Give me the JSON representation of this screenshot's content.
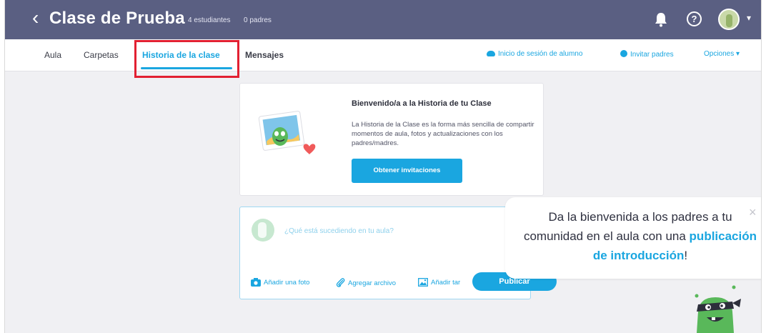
{
  "header": {
    "back_glyph": "‹",
    "class_name": "Clase de Prueba",
    "students_count": "4 estudiantes",
    "parents_count": "0 padres",
    "help_glyph": "?",
    "caret": "▾"
  },
  "nav": {
    "tabs": [
      {
        "label": "Aula"
      },
      {
        "label": "Carpetas"
      },
      {
        "label": "Historia de la clase",
        "active": true
      },
      {
        "label": "Mensajes"
      }
    ],
    "actions": {
      "student_login": "Inicio de sesión de alumno",
      "invite_parents": "Invitar padres",
      "options": "Opciones",
      "options_caret": "▾"
    }
  },
  "welcome": {
    "title": "Bienvenido/a a la Historia de tu Clase",
    "body": "La Historia de la Clase es la forma más sencilla de compartir momentos de aula, fotos y actualizaciones con los padres/madres.",
    "button": "Obtener invitaciones"
  },
  "composer": {
    "placeholder": "¿Qué está sucediendo en tu aula?",
    "add_photo": "Añadir una foto",
    "attach_file": "Agregar archivo",
    "add_other": "Añadir tar",
    "publish": "Publicar"
  },
  "callout": {
    "text_before": "Da la bienvenida a los padres a tu comunidad en el aula con una",
    "text_strong": "publicación de introducción",
    "text_after": "!",
    "close": "×"
  },
  "colors": {
    "topbar": "#5a5f82",
    "accent": "#1aa6e0",
    "highlight": "#e22032",
    "background": "#f0f0f3"
  }
}
